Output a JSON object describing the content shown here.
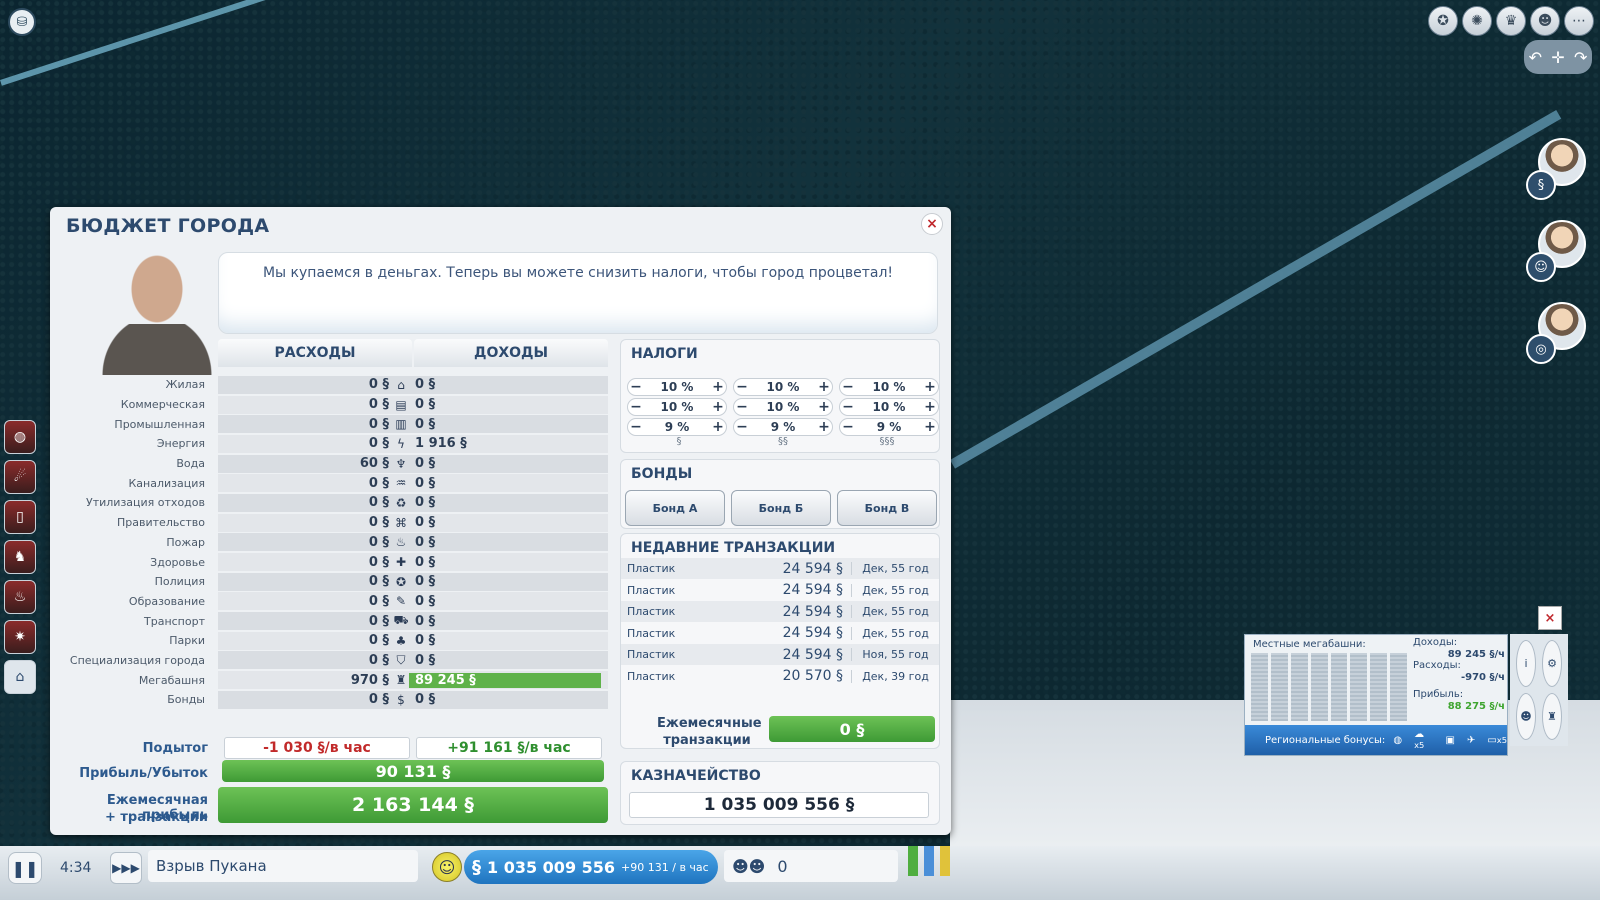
{
  "budget": {
    "title": "БЮДЖЕТ ГОРОДА",
    "close_glyph": "×",
    "advisor_message": "Мы купаемся в деньгах. Теперь вы можете снизить налоги, чтобы город процветал!",
    "expenses_header": "РАСХОДЫ",
    "income_header": "ДОХОДЫ",
    "rows": [
      {
        "label": "Жилая",
        "expense": "0 §",
        "icon": "house-icon",
        "glyph": "⌂",
        "income": "0 §"
      },
      {
        "label": "Коммерческая",
        "expense": "0 §",
        "icon": "store-icon",
        "glyph": "▤",
        "income": "0 §"
      },
      {
        "label": "Промышленная",
        "expense": "0 §",
        "icon": "factory-icon",
        "glyph": "▥",
        "income": "0 §"
      },
      {
        "label": "Энергия",
        "expense": "0 §",
        "icon": "lightning-icon",
        "glyph": "ϟ",
        "income": "1 916 §"
      },
      {
        "label": "Вода",
        "expense": "60 §",
        "icon": "faucet-icon",
        "glyph": "♆",
        "income": "0 §"
      },
      {
        "label": "Канализация",
        "expense": "0 §",
        "icon": "sewage-icon",
        "glyph": "♒",
        "income": "0 §"
      },
      {
        "label": "Утилизация отходов",
        "expense": "0 §",
        "icon": "trash-icon",
        "glyph": "♻",
        "income": "0 §"
      },
      {
        "label": "Правительство",
        "expense": "0 §",
        "icon": "government-icon",
        "glyph": "⌘",
        "income": "0 §"
      },
      {
        "label": "Пожар",
        "expense": "0 §",
        "icon": "fire-helmet-icon",
        "glyph": "♨",
        "income": "0 §"
      },
      {
        "label": "Здоровье",
        "expense": "0 §",
        "icon": "health-icon",
        "glyph": "✚",
        "income": "0 §"
      },
      {
        "label": "Полиция",
        "expense": "0 §",
        "icon": "police-icon",
        "glyph": "✪",
        "income": "0 §"
      },
      {
        "label": "Образование",
        "expense": "0 §",
        "icon": "education-icon",
        "glyph": "✎",
        "income": "0 §"
      },
      {
        "label": "Транспорт",
        "expense": "0 §",
        "icon": "bus-icon",
        "glyph": "⛟",
        "income": "0 §"
      },
      {
        "label": "Парки",
        "expense": "0 §",
        "icon": "tree-icon",
        "glyph": "♣",
        "income": "0 §"
      },
      {
        "label": "Специализация города",
        "expense": "0 §",
        "icon": "shield-icon",
        "glyph": "⛉",
        "income": "0 §"
      },
      {
        "label": "Мегабашня",
        "expense": "970 §",
        "icon": "megatower-icon",
        "glyph": "♜",
        "income": "89 245 §"
      },
      {
        "label": "Бонды",
        "expense": "0 §",
        "icon": "money-bag-icon",
        "glyph": "$",
        "income": "0 §"
      }
    ],
    "subtotal_label": "Подытог",
    "subtotal_expense": "-1 030 §/в час",
    "subtotal_income": "+91 161 §/в час",
    "profit_label": "Прибыль/Убыток",
    "profit_value": "90 131 §",
    "monthly_label_1": "Ежемесячная прибыль",
    "monthly_label_2": "+ транзакции",
    "monthly_value": "2 163 144 §",
    "taxes": {
      "header": "НАЛОГИ",
      "rows": [
        [
          "10 %",
          "10 %",
          "10 %"
        ],
        [
          "10 %",
          "10 %",
          "10 %"
        ],
        [
          "9 %",
          "9 %",
          "9 %"
        ]
      ],
      "wealth_labels": [
        "§",
        "§§",
        "§§§"
      ],
      "minus": "−",
      "plus": "+"
    },
    "bonds": {
      "header": "БОНДЫ",
      "buttons": [
        "Бонд А",
        "Бонд Б",
        "Бонд В"
      ]
    },
    "transactions": {
      "header": "НЕДАВНИЕ ТРАНЗАКЦИИ",
      "items": [
        {
          "name": "Пластик",
          "amount": "24 594 §",
          "date": "Дек, 55 год"
        },
        {
          "name": "Пластик",
          "amount": "24 594 §",
          "date": "Дек, 55 год"
        },
        {
          "name": "Пластик",
          "amount": "24 594 §",
          "date": "Дек, 55 год"
        },
        {
          "name": "Пластик",
          "amount": "24 594 §",
          "date": "Дек, 55 год"
        },
        {
          "name": "Пластик",
          "amount": "24 594 §",
          "date": "Ноя, 55 год"
        },
        {
          "name": "Пластик",
          "amount": "20 570 §",
          "date": "Дек, 39 год"
        }
      ],
      "monthly_label_1": "Ежемесячные",
      "monthly_label_2": "транзакции",
      "monthly_value": "0 §"
    },
    "treasury": {
      "header": "КАЗНАЧЕЙСТВО",
      "value": "1 035 009 556 §"
    }
  },
  "megatower": {
    "title": "Местные мегабашни:",
    "income_label": "Доходы:",
    "income_value": "89 245 §/ч",
    "expense_label": "Расходы:",
    "expense_value": "-970 §/ч",
    "profit_label": "Прибыль:",
    "profit_value": "88 275 §/ч",
    "regional_label": "Региональные бонусы:",
    "bonus_1": "x5",
    "bonus_2": "x5",
    "close_glyph": "×"
  },
  "bottom_bar": {
    "time": "4:34",
    "city_name": "Взрыв Пукана",
    "money": "1 035 009 556",
    "money_rate": "+90 131 / в час",
    "money_symbol": "§",
    "population": "0",
    "pause_glyph": "❚❚",
    "speed_glyph": "▶▶▶"
  },
  "colors": {
    "accent_blue": "#2d4a6e",
    "profit_green": "#4fae40",
    "loss_red": "#c12a2a",
    "money_blue": "#1f74bf"
  }
}
